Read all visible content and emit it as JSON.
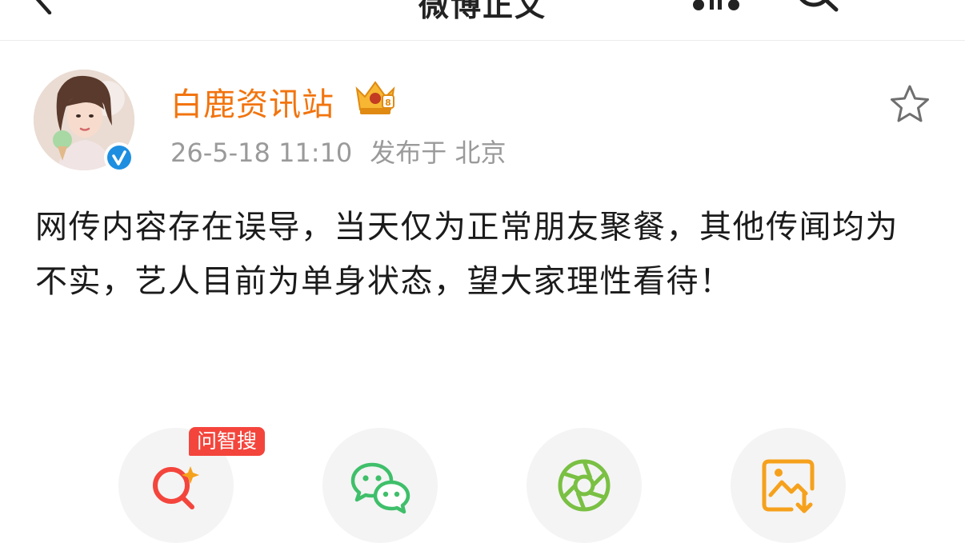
{
  "nav": {
    "title": "微博正文"
  },
  "author": {
    "name": "白鹿资讯站",
    "verified": true,
    "timestamp": "26-5-18 11:10",
    "location": "发布于 北京"
  },
  "post": {
    "text": "网传内容存在误导，当天仅为正常朋友聚餐，其他传闻均为不实，艺人目前为单身状态，望大家理性看待！"
  },
  "share": {
    "items": [
      {
        "icon": "ai-search-icon",
        "badge": "问智搜"
      },
      {
        "icon": "wechat-icon"
      },
      {
        "icon": "moments-icon"
      },
      {
        "icon": "save-image-icon"
      }
    ]
  },
  "colors": {
    "author_name": "#f2740e",
    "meta_text": "#9a9a9a",
    "verified_blue": "#1e8ee0",
    "ai_red": "#f4453c",
    "wechat_green": "#3fbf6a",
    "moments_green": "#7ac043",
    "save_orange": "#f6a11c"
  }
}
